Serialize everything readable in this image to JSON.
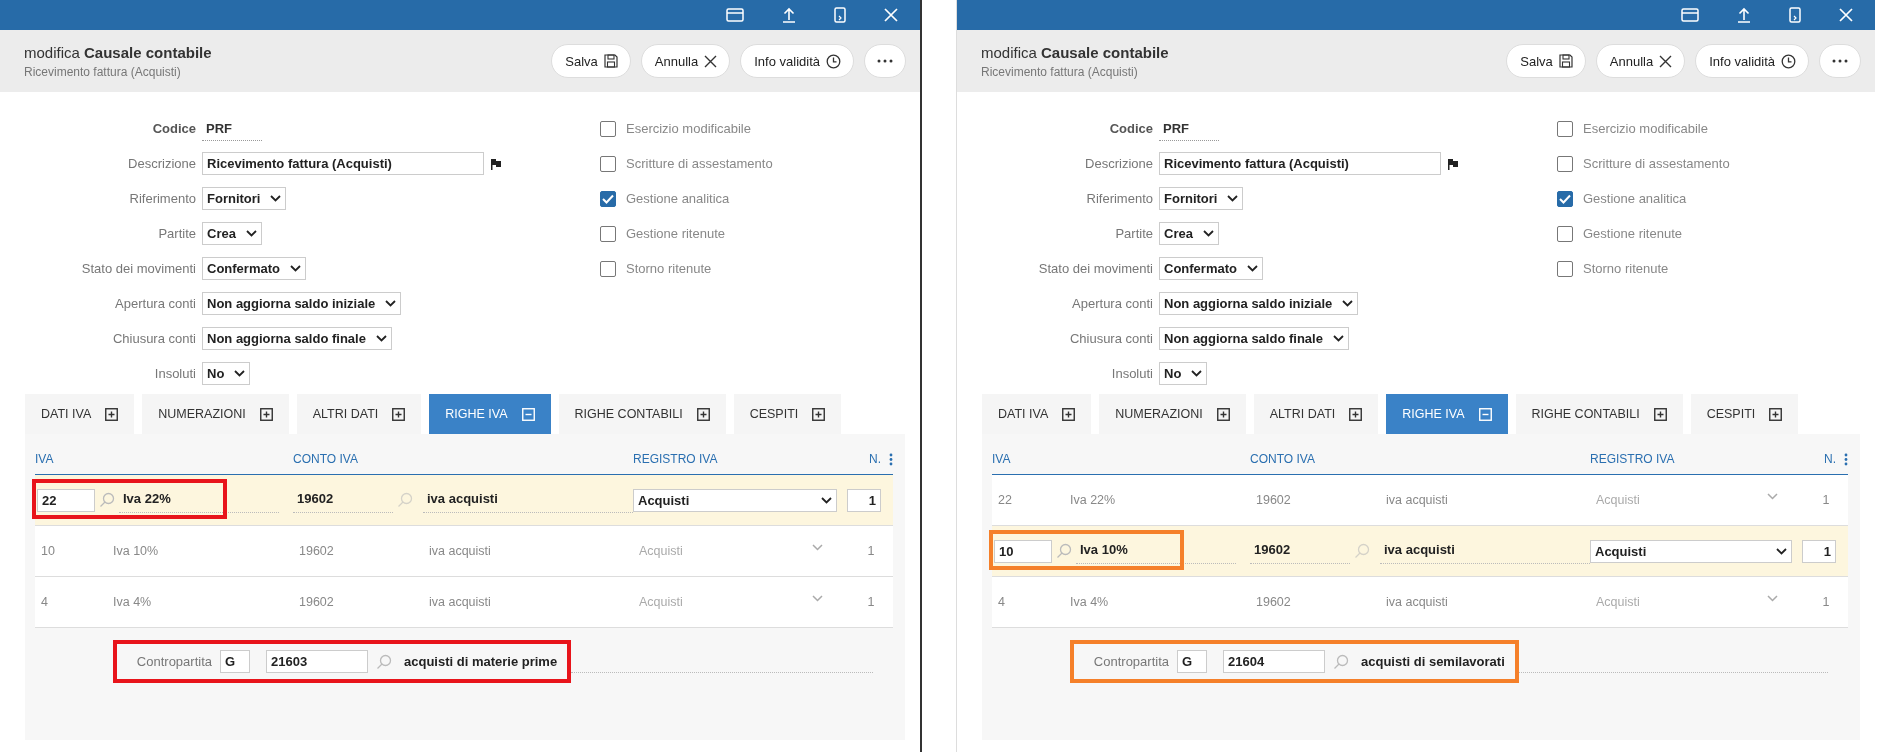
{
  "panels": [
    {
      "color": "#e8141b",
      "title_prefix": "modifica",
      "title": "Causale contabile",
      "subtitle": "Ricevimento fattura (Acquisti)",
      "buttons": [
        {
          "label": "Salva",
          "kind": "save"
        },
        {
          "label": "Annulla",
          "kind": "cancel"
        },
        {
          "label": "Info validità",
          "kind": "clock"
        },
        {
          "kind": "more"
        }
      ],
      "fields": [
        {
          "label": "Codice",
          "value": "PRF",
          "kind": "code"
        },
        {
          "label": "Descrizione",
          "value": "Ricevimento fattura (Acquisti)",
          "kind": "input"
        },
        {
          "label": "Riferimento",
          "value": "Fornitori",
          "kind": "select"
        },
        {
          "label": "Partite",
          "value": "Crea",
          "kind": "select"
        },
        {
          "label": "Stato dei movimenti",
          "value": "Confermato",
          "kind": "select"
        },
        {
          "label": "Apertura conti",
          "value": "Non aggiorna saldo iniziale",
          "kind": "select"
        },
        {
          "label": "Chiusura conti",
          "value": "Non aggiorna saldo finale",
          "kind": "select"
        },
        {
          "label": "Insoluti",
          "value": "No",
          "kind": "select"
        }
      ],
      "checkboxes": [
        {
          "label": "Esercizio modificabile",
          "checked": false
        },
        {
          "label": "Scritture di assestamento",
          "checked": false
        },
        {
          "label": "Gestione analitica",
          "checked": true
        },
        {
          "label": "Gestione ritenute",
          "checked": false
        },
        {
          "label": "Storno ritenute",
          "checked": false
        }
      ],
      "tabs": [
        {
          "label": "DATI IVA",
          "selected": false
        },
        {
          "label": "NUMERAZIONI",
          "selected": false
        },
        {
          "label": "ALTRI DATI",
          "selected": false
        },
        {
          "label": "RIGHE IVA",
          "selected": true
        },
        {
          "label": "RIGHE CONTABILI",
          "selected": false
        },
        {
          "label": "CESPITI",
          "selected": false
        }
      ],
      "columns": [
        "IVA",
        "CONTO IVA",
        "REGISTRO IVA",
        "N."
      ],
      "rows": [
        {
          "iva": "22",
          "iva_desc": "Iva 22%",
          "conto": "19602",
          "conto_desc": "iva acquisti",
          "registro": "Acquisti",
          "n": "1",
          "selected": true
        },
        {
          "iva": "10",
          "iva_desc": "Iva 10%",
          "conto": "19602",
          "conto_desc": "iva acquisti",
          "registro": "Acquisti",
          "n": "1",
          "selected": false
        },
        {
          "iva": "4",
          "iva_desc": "Iva 4%",
          "conto": "19602",
          "conto_desc": "iva acquisti",
          "registro": "Acquisti",
          "n": "1",
          "selected": false
        }
      ],
      "contropartita": {
        "label": "Contropartita",
        "type": "G",
        "conto": "21603",
        "desc": "acquisti di materie prime"
      }
    },
    {
      "color": "#f5802a",
      "title_prefix": "modifica",
      "title": "Causale contabile",
      "subtitle": "Ricevimento fattura (Acquisti)",
      "buttons": [
        {
          "label": "Salva",
          "kind": "save"
        },
        {
          "label": "Annulla",
          "kind": "cancel"
        },
        {
          "label": "Info validità",
          "kind": "clock"
        },
        {
          "kind": "more"
        }
      ],
      "fields": [
        {
          "label": "Codice",
          "value": "PRF",
          "kind": "code"
        },
        {
          "label": "Descrizione",
          "value": "Ricevimento fattura (Acquisti)",
          "kind": "input"
        },
        {
          "label": "Riferimento",
          "value": "Fornitori",
          "kind": "select"
        },
        {
          "label": "Partite",
          "value": "Crea",
          "kind": "select"
        },
        {
          "label": "Stato dei movimenti",
          "value": "Confermato",
          "kind": "select"
        },
        {
          "label": "Apertura conti",
          "value": "Non aggiorna saldo iniziale",
          "kind": "select"
        },
        {
          "label": "Chiusura conti",
          "value": "Non aggiorna saldo finale",
          "kind": "select"
        },
        {
          "label": "Insoluti",
          "value": "No",
          "kind": "select"
        }
      ],
      "checkboxes": [
        {
          "label": "Esercizio modificabile",
          "checked": false
        },
        {
          "label": "Scritture di assestamento",
          "checked": false
        },
        {
          "label": "Gestione analitica",
          "checked": true
        },
        {
          "label": "Gestione ritenute",
          "checked": false
        },
        {
          "label": "Storno ritenute",
          "checked": false
        }
      ],
      "tabs": [
        {
          "label": "DATI IVA",
          "selected": false
        },
        {
          "label": "NUMERAZIONI",
          "selected": false
        },
        {
          "label": "ALTRI DATI",
          "selected": false
        },
        {
          "label": "RIGHE IVA",
          "selected": true
        },
        {
          "label": "RIGHE CONTABILI",
          "selected": false
        },
        {
          "label": "CESPITI",
          "selected": false
        }
      ],
      "columns": [
        "IVA",
        "CONTO IVA",
        "REGISTRO IVA",
        "N."
      ],
      "rows": [
        {
          "iva": "22",
          "iva_desc": "Iva 22%",
          "conto": "19602",
          "conto_desc": "iva acquisti",
          "registro": "Acquisti",
          "n": "1",
          "selected": false
        },
        {
          "iva": "10",
          "iva_desc": "Iva 10%",
          "conto": "19602",
          "conto_desc": "iva acquisti",
          "registro": "Acquisti",
          "n": "1",
          "selected": true
        },
        {
          "iva": "4",
          "iva_desc": "Iva 4%",
          "conto": "19602",
          "conto_desc": "iva acquisti",
          "registro": "Acquisti",
          "n": "1",
          "selected": false
        }
      ],
      "contropartita": {
        "label": "Contropartita",
        "type": "G",
        "conto": "21604",
        "desc": "acquisti di semilavorati"
      }
    }
  ]
}
